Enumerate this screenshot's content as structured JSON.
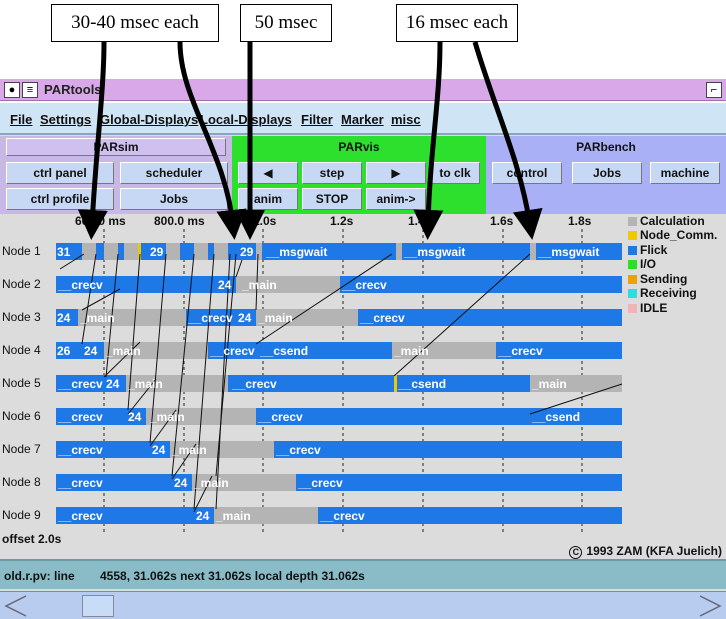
{
  "callouts": [
    {
      "label": "30-40 msec each"
    },
    {
      "label": "50 msec"
    },
    {
      "label": "16 msec each"
    }
  ],
  "window": {
    "title": "PARtools"
  },
  "menu": [
    {
      "label": "File"
    },
    {
      "label": "Settings"
    },
    {
      "label": "Global-Displays"
    },
    {
      "label": "Local-Displays"
    },
    {
      "label": "Filter"
    },
    {
      "label": "Marker"
    },
    {
      "label": "misc"
    }
  ],
  "parsim": {
    "title": "PARsim",
    "buttons": [
      "ctrl panel",
      "scheduler",
      "ctrl profile",
      "Jobs"
    ]
  },
  "parvis": {
    "title": "PARvis",
    "buttons": [
      "◀",
      "step",
      "▶",
      "to clk",
      "anim",
      "STOP",
      "anim->"
    ]
  },
  "parbench": {
    "title": "PARbench",
    "buttons": [
      "control",
      "Jobs",
      "machine"
    ]
  },
  "timeline": {
    "ticks": [
      "600.0 ms",
      "800.0 ms",
      "1.0s",
      "1.2s",
      "1.4s",
      "1.6s",
      "1.8s"
    ],
    "nodes": [
      "Node 1",
      "Node 2",
      "Node 3",
      "Node 4",
      "Node 5",
      "Node 6",
      "Node 7",
      "Node 8",
      "Node 9"
    ],
    "segment_labels": {
      "msgwait": "__msgwait",
      "crecv": "__crecv",
      "main": "_main",
      "csend": "__csend"
    },
    "legend": [
      {
        "label": "Calculation",
        "color": "#b4b4b4"
      },
      {
        "label": "Node_Comm.",
        "color": "#f0c800"
      },
      {
        "label": "Flick",
        "color": "#1e78e6"
      },
      {
        "label": "I/O",
        "color": "#28e028"
      },
      {
        "label": "Sending",
        "color": "#f0a000"
      },
      {
        "label": "Receiving",
        "color": "#28e0e0"
      },
      {
        "label": "IDLE",
        "color": "#f0b4b4"
      }
    ],
    "offset": "offset 2.0s",
    "copyright": "1993 ZAM (KFA Juelich)"
  },
  "status": {
    "file": "old.r.pv: line",
    "info": "4558, 31.062s next 31.062s local depth 31.062s"
  }
}
